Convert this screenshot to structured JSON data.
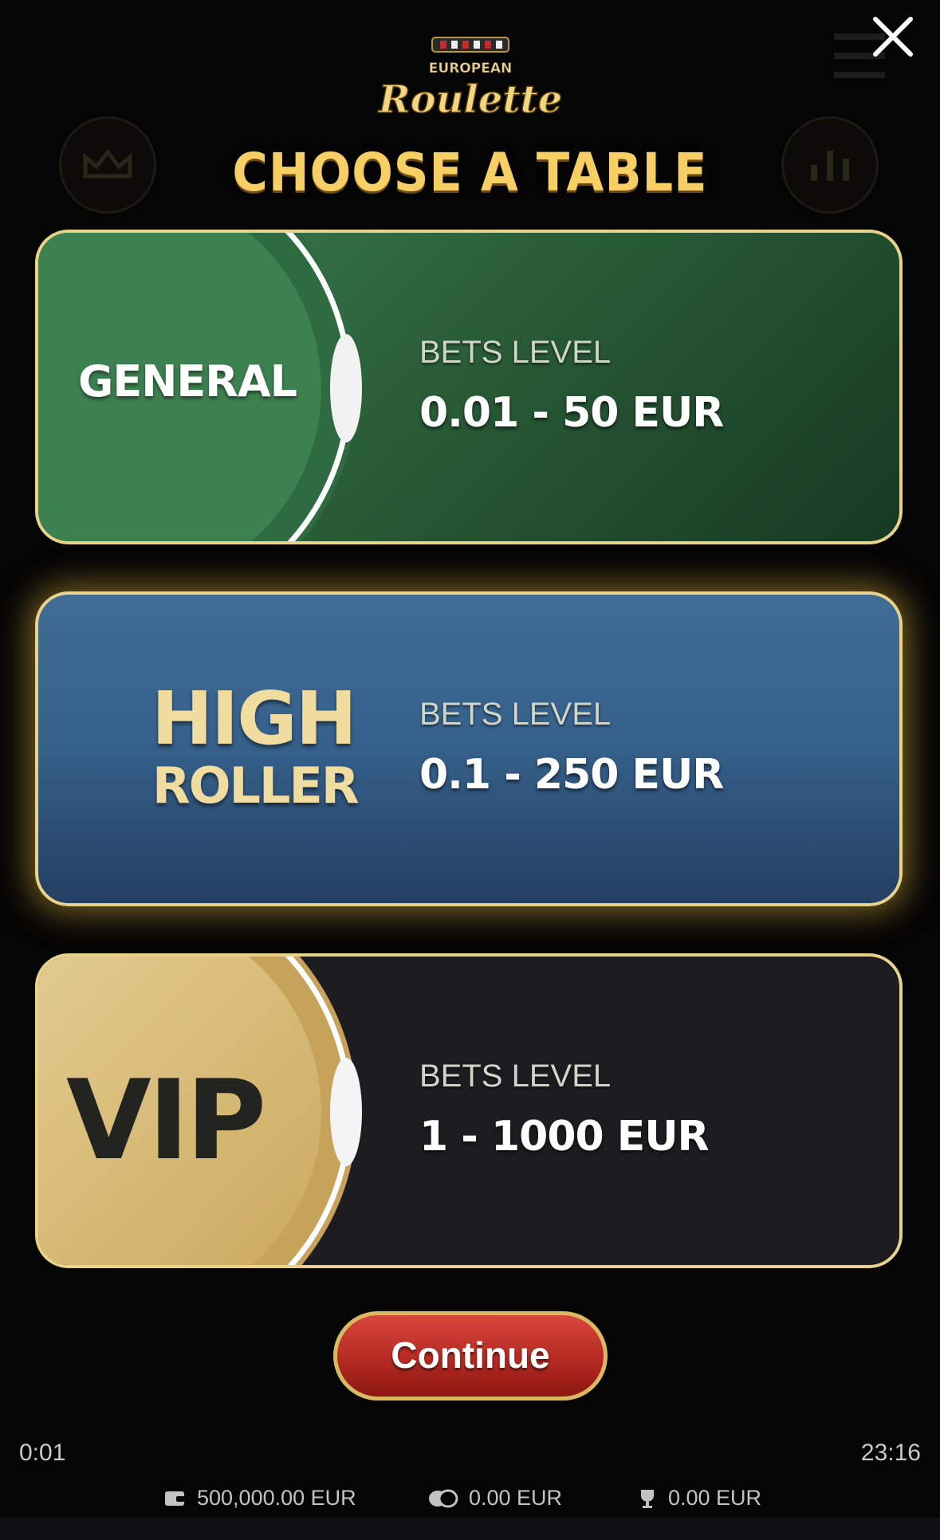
{
  "header": {
    "logo_text_top": "EUROPEAN",
    "logo_text_main": "Roulette",
    "title": "CHOOSE A TABLE"
  },
  "tables": [
    {
      "name": "GENERAL",
      "bets_label": "BETS LEVEL",
      "bets_range": "0.01 - 50 EUR"
    },
    {
      "name_line1": "HIGH",
      "name_line2": "ROLLER",
      "bets_label": "BETS LEVEL",
      "bets_range": "0.1 - 250 EUR"
    },
    {
      "name": "VIP",
      "bets_label": "BETS LEVEL",
      "bets_range": "1 - 1000 EUR"
    }
  ],
  "selected_table": "HIGH ROLLER",
  "continue_label": "Continue",
  "status": {
    "elapsed": "0:01",
    "clock": "23:16"
  },
  "footer": {
    "balance": "500,000.00 EUR",
    "bet": "0.00 EUR",
    "win": "0.00 EUR"
  },
  "colors": {
    "title_gold": "#f7cf64",
    "border_gold": "#e9d38a",
    "general_green": "#2a5e38",
    "high_roller_blue": "#35608a",
    "vip_dark": "#1d1d21",
    "continue_red": "#b42a22"
  }
}
